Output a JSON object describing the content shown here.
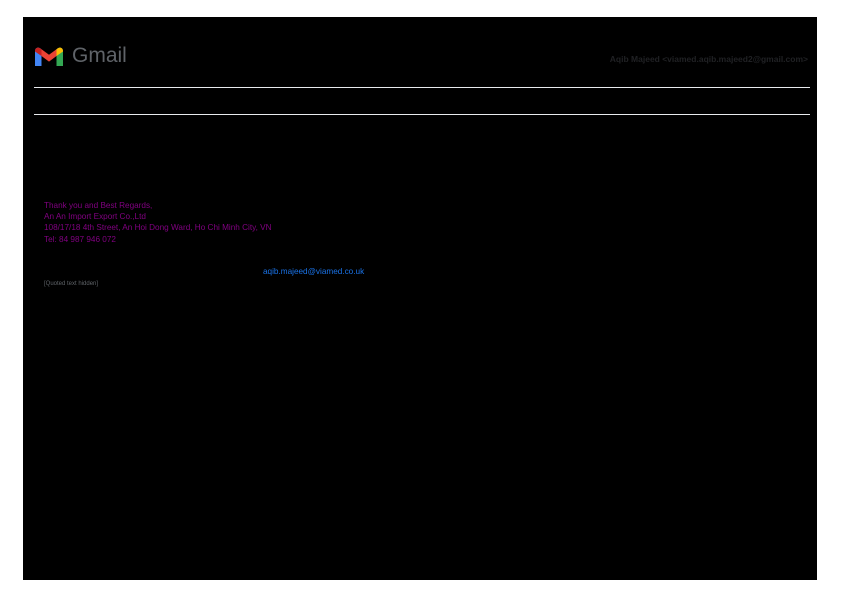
{
  "header": {
    "logo_text": "Gmail",
    "logo_icon": "gmail-m-icon",
    "account": "Aqib Majeed <viamed.aqib.majeed2@gmail.com>"
  },
  "signature": {
    "lines": [
      "Thank you and Best Regards,",
      "An An Import Export Co.,Ltd",
      "108/17/18 4th Street, An Hoi Dong Ward, Ho Chi Minh City, VN",
      "Tel: 84 987 946 072"
    ]
  },
  "body": {
    "email_link": "aqib.majeed@viamed.co.uk",
    "quoted_text": "[Quoted text hidden]"
  },
  "colors": {
    "signature": "#800080",
    "link": "#1a73e8",
    "background": "#000000"
  }
}
